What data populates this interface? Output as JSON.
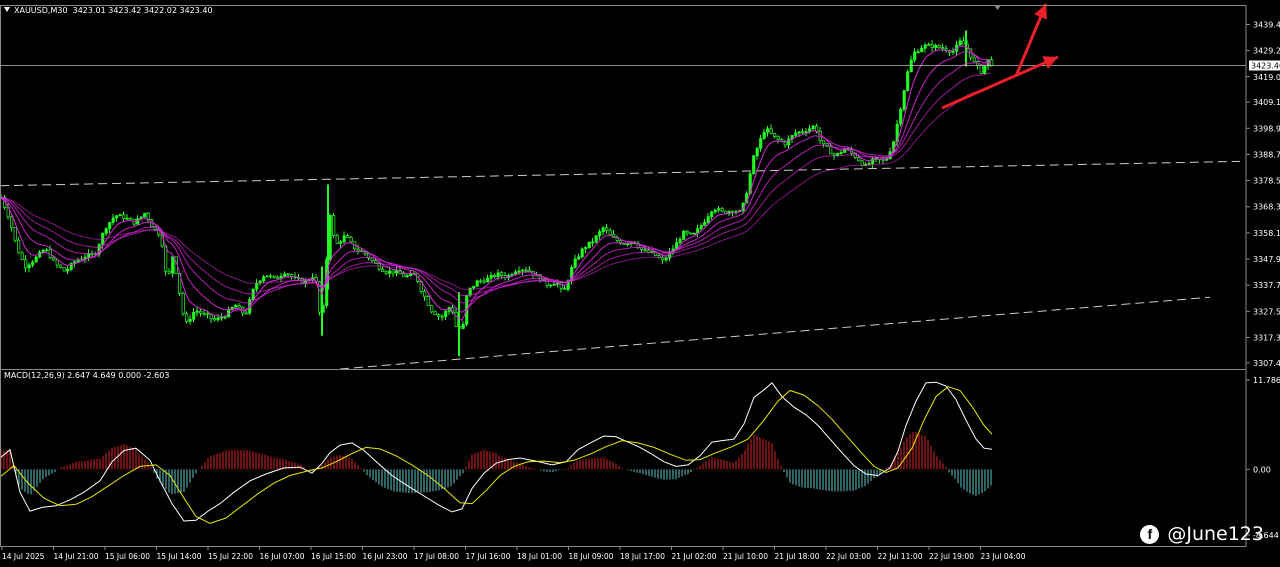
{
  "header": {
    "symbol": "XAUUSD,M30",
    "ohlc": "3423.01 3423.42 3422.02 3423.40",
    "macd_label": "MACD(12,26,9) 2.647 4.649 0.000 -2.603"
  },
  "watermark": {
    "text": "@June123",
    "icon": "facebook-icon"
  },
  "colors": {
    "bull": "#22ff22",
    "ma": "#dd22dd",
    "macd_line": "#ffffff",
    "signal": "#e8e800",
    "hist_pos": "#dd2222",
    "hist_neg": "#5ec8c8",
    "arrow": "#e8202a",
    "trendline": "#cccccc"
  },
  "chart_data": [
    {
      "type": "candlestick",
      "symbol": "XAUUSD",
      "timeframe": "M30",
      "ylim": [
        3305,
        3447
      ],
      "y_ticks": [
        3439.4,
        3429.2,
        3419.0,
        3409.1,
        3398.9,
        3388.7,
        3378.5,
        3368.3,
        3358.1,
        3347.9,
        3337.7,
        3327.5,
        3317.3,
        3307.4
      ],
      "y_tick_labels": [
        "3439.40",
        "3429.20",
        "3419.00",
        "3409.10",
        "3398.90",
        "3388.70",
        "3378.50",
        "3368.30",
        "3358.10",
        "3347.90",
        "3337.70",
        "3327.50",
        "3317.30",
        "3307.40"
      ],
      "current_price": 3423.4,
      "current_price_label": "3423.40",
      "x_labels": [
        "14 Jul 2025",
        "14 Jul 21:00",
        "15 Jul 06:00",
        "15 Jul 14:00",
        "15 Jul 22:00",
        "16 Jul 07:00",
        "16 Jul 15:00",
        "16 Jul 23:00",
        "17 Jul 08:00",
        "17 Jul 16:00",
        "18 Jul 01:00",
        "18 Jul 09:00",
        "18 Jul 17:00",
        "21 Jul 02:00",
        "21 Jul 10:00",
        "21 Jul 18:00",
        "22 Jul 03:00",
        "22 Jul 11:00",
        "22 Jul 19:00",
        "23 Jul 04:00"
      ],
      "close_path": [
        [
          0,
          3372
        ],
        [
          8,
          3364
        ],
        [
          16,
          3352
        ],
        [
          24,
          3345
        ],
        [
          34,
          3348
        ],
        [
          44,
          3352
        ],
        [
          54,
          3346
        ],
        [
          64,
          3343
        ],
        [
          74,
          3347
        ],
        [
          84,
          3349
        ],
        [
          94,
          3350
        ],
        [
          104,
          3360
        ],
        [
          114,
          3365
        ],
        [
          124,
          3364
        ],
        [
          134,
          3362
        ],
        [
          144,
          3366
        ],
        [
          152,
          3360
        ],
        [
          160,
          3357
        ],
        [
          166,
          3338
        ],
        [
          172,
          3350
        ],
        [
          178,
          3336
        ],
        [
          184,
          3322
        ],
        [
          194,
          3328
        ],
        [
          204,
          3326
        ],
        [
          214,
          3324
        ],
        [
          224,
          3326
        ],
        [
          234,
          3330
        ],
        [
          244,
          3326
        ],
        [
          254,
          3338
        ],
        [
          264,
          3342
        ],
        [
          274,
          3340
        ],
        [
          284,
          3343
        ],
        [
          294,
          3340
        ],
        [
          304,
          3339
        ],
        [
          314,
          3342
        ],
        [
          320,
          3322
        ],
        [
          324,
          3336
        ],
        [
          328,
          3368
        ],
        [
          334,
          3353
        ],
        [
          344,
          3357
        ],
        [
          354,
          3352
        ],
        [
          364,
          3350
        ],
        [
          374,
          3346
        ],
        [
          384,
          3343
        ],
        [
          394,
          3343
        ],
        [
          404,
          3341
        ],
        [
          414,
          3342
        ],
        [
          420,
          3336
        ],
        [
          430,
          3328
        ],
        [
          440,
          3325
        ],
        [
          450,
          3330
        ],
        [
          456,
          3320
        ],
        [
          462,
          3322
        ],
        [
          466,
          3335
        ],
        [
          476,
          3339
        ],
        [
          486,
          3340
        ],
        [
          496,
          3342
        ],
        [
          506,
          3341
        ],
        [
          516,
          3344
        ],
        [
          526,
          3344
        ],
        [
          536,
          3341
        ],
        [
          546,
          3338
        ],
        [
          556,
          3339
        ],
        [
          562,
          3334
        ],
        [
          572,
          3346
        ],
        [
          582,
          3352
        ],
        [
          592,
          3355
        ],
        [
          602,
          3360
        ],
        [
          612,
          3356
        ],
        [
          622,
          3354
        ],
        [
          632,
          3355
        ],
        [
          642,
          3351
        ],
        [
          652,
          3350
        ],
        [
          662,
          3347
        ],
        [
          672,
          3352
        ],
        [
          682,
          3358
        ],
        [
          692,
          3357
        ],
        [
          702,
          3362
        ],
        [
          712,
          3368
        ],
        [
          722,
          3366
        ],
        [
          732,
          3367
        ],
        [
          740,
          3366
        ],
        [
          746,
          3375
        ],
        [
          752,
          3387
        ],
        [
          758,
          3393
        ],
        [
          764,
          3399
        ],
        [
          774,
          3395
        ],
        [
          784,
          3393
        ],
        [
          794,
          3397
        ],
        [
          804,
          3398
        ],
        [
          814,
          3400
        ],
        [
          820,
          3393
        ],
        [
          826,
          3391
        ],
        [
          834,
          3388
        ],
        [
          844,
          3391
        ],
        [
          854,
          3388
        ],
        [
          864,
          3384
        ],
        [
          874,
          3387
        ],
        [
          884,
          3386
        ],
        [
          892,
          3393
        ],
        [
          900,
          3408
        ],
        [
          906,
          3420
        ],
        [
          912,
          3428
        ],
        [
          922,
          3431
        ],
        [
          932,
          3431
        ],
        [
          942,
          3430
        ],
        [
          952,
          3429
        ],
        [
          960,
          3433
        ],
        [
          966,
          3430
        ],
        [
          972,
          3425
        ],
        [
          980,
          3421
        ],
        [
          988,
          3426
        ],
        [
          992,
          3423
        ]
      ],
      "ma_lags": [
        6,
        12,
        20,
        30,
        44
      ],
      "trendlines": [
        {
          "from": [
            0,
            3376.5
          ],
          "to": [
            1240,
            3386
          ]
        },
        {
          "from": [
            340,
            3305
          ],
          "to": [
            1210,
            3333
          ]
        }
      ]
    },
    {
      "type": "macd",
      "params": "12,26,9",
      "ylim": [
        -8.644,
        11.786
      ],
      "y_tick_labels": [
        "11.786",
        "0.00",
        "-8.644"
      ],
      "series": [
        {
          "name": "MACD",
          "points": [
            [
              0,
              1.5
            ],
            [
              10,
              2.6
            ],
            [
              20,
              -3
            ],
            [
              30,
              -5.5
            ],
            [
              42,
              -5
            ],
            [
              56,
              -4.8
            ],
            [
              70,
              -4
            ],
            [
              84,
              -3
            ],
            [
              100,
              -1.5
            ],
            [
              112,
              1.0
            ],
            [
              124,
              2.5
            ],
            [
              136,
              2.8
            ],
            [
              150,
              1.2
            ],
            [
              160,
              -1.5
            ],
            [
              172,
              -4.5
            ],
            [
              184,
              -6.8
            ],
            [
              196,
              -6.7
            ],
            [
              208,
              -5.5
            ],
            [
              220,
              -4.5
            ],
            [
              234,
              -3
            ],
            [
              250,
              -1.5
            ],
            [
              266,
              -0.6
            ],
            [
              284,
              0.2
            ],
            [
              300,
              0.3
            ],
            [
              312,
              -0.5
            ],
            [
              322,
              0.8
            ],
            [
              330,
              2.2
            ],
            [
              340,
              3.2
            ],
            [
              352,
              3.5
            ],
            [
              364,
              2.5
            ],
            [
              378,
              0.8
            ],
            [
              392,
              -0.8
            ],
            [
              408,
              -2.2
            ],
            [
              424,
              -3.5
            ],
            [
              440,
              -4.8
            ],
            [
              452,
              -5.6
            ],
            [
              462,
              -5.2
            ],
            [
              472,
              -2.5
            ],
            [
              484,
              -0.5
            ],
            [
              496,
              0.8
            ],
            [
              508,
              1.3
            ],
            [
              520,
              1.5
            ],
            [
              536,
              1.1
            ],
            [
              552,
              0.6
            ],
            [
              566,
              1.0
            ],
            [
              578,
              2.6
            ],
            [
              592,
              3.6
            ],
            [
              604,
              4.4
            ],
            [
              616,
              4.3
            ],
            [
              628,
              3.6
            ],
            [
              640,
              2.9
            ],
            [
              652,
              2.0
            ],
            [
              664,
              1.0
            ],
            [
              676,
              0.4
            ],
            [
              688,
              0.6
            ],
            [
              700,
              1.8
            ],
            [
              712,
              3.6
            ],
            [
              722,
              3.8
            ],
            [
              734,
              4.0
            ],
            [
              744,
              6.0
            ],
            [
              754,
              9.5
            ],
            [
              764,
              10.5
            ],
            [
              772,
              11.4
            ],
            [
              782,
              9.6
            ],
            [
              794,
              8.2
            ],
            [
              806,
              7.2
            ],
            [
              818,
              5.8
            ],
            [
              830,
              4.0
            ],
            [
              842,
              2.2
            ],
            [
              854,
              0.5
            ],
            [
              866,
              -0.6
            ],
            [
              878,
              -0.8
            ],
            [
              890,
              0.2
            ],
            [
              898,
              2.4
            ],
            [
              906,
              5.8
            ],
            [
              916,
              9.0
            ],
            [
              926,
              11.4
            ],
            [
              936,
              11.5
            ],
            [
              946,
              11.0
            ],
            [
              956,
              9.2
            ],
            [
              966,
              6.5
            ],
            [
              976,
              4.0
            ],
            [
              984,
              2.8
            ],
            [
              992,
              2.65
            ]
          ]
        },
        {
          "name": "Signal",
          "points": [
            [
              0,
              -1.0
            ],
            [
              14,
              0.5
            ],
            [
              28,
              -1.8
            ],
            [
              44,
              -3.8
            ],
            [
              60,
              -4.8
            ],
            [
              76,
              -4.6
            ],
            [
              92,
              -3.6
            ],
            [
              108,
              -2.2
            ],
            [
              124,
              -0.8
            ],
            [
              140,
              0.4
            ],
            [
              156,
              0.6
            ],
            [
              170,
              -0.8
            ],
            [
              184,
              -3.8
            ],
            [
              196,
              -6.2
            ],
            [
              210,
              -7.1
            ],
            [
              226,
              -6.4
            ],
            [
              242,
              -4.8
            ],
            [
              258,
              -3.2
            ],
            [
              274,
              -1.8
            ],
            [
              290,
              -0.8
            ],
            [
              308,
              -0.2
            ],
            [
              322,
              0.2
            ],
            [
              336,
              1.0
            ],
            [
              352,
              2.1
            ],
            [
              366,
              2.9
            ],
            [
              380,
              2.7
            ],
            [
              396,
              1.8
            ],
            [
              412,
              0.6
            ],
            [
              428,
              -0.8
            ],
            [
              444,
              -2.5
            ],
            [
              460,
              -4.4
            ],
            [
              472,
              -4.5
            ],
            [
              486,
              -2.8
            ],
            [
              500,
              -0.8
            ],
            [
              514,
              0.4
            ],
            [
              528,
              1.0
            ],
            [
              544,
              1.1
            ],
            [
              560,
              0.9
            ],
            [
              574,
              1.2
            ],
            [
              590,
              2.0
            ],
            [
              606,
              3.0
            ],
            [
              622,
              3.8
            ],
            [
              638,
              3.5
            ],
            [
              654,
              2.9
            ],
            [
              670,
              2.0
            ],
            [
              686,
              1.2
            ],
            [
              700,
              1.3
            ],
            [
              716,
              2.2
            ],
            [
              732,
              3.0
            ],
            [
              748,
              4.0
            ],
            [
              764,
              6.5
            ],
            [
              778,
              9.0
            ],
            [
              790,
              10.4
            ],
            [
              804,
              9.8
            ],
            [
              818,
              8.4
            ],
            [
              832,
              6.6
            ],
            [
              846,
              4.5
            ],
            [
              860,
              2.4
            ],
            [
              874,
              0.4
            ],
            [
              886,
              -0.4
            ],
            [
              898,
              0.2
            ],
            [
              912,
              2.8
            ],
            [
              924,
              6.5
            ],
            [
              936,
              9.6
            ],
            [
              948,
              10.9
            ],
            [
              960,
              10.4
            ],
            [
              972,
              8.3
            ],
            [
              984,
              5.8
            ],
            [
              992,
              4.65
            ]
          ]
        }
      ],
      "histogram_mode": "macd_minus_signal"
    }
  ]
}
